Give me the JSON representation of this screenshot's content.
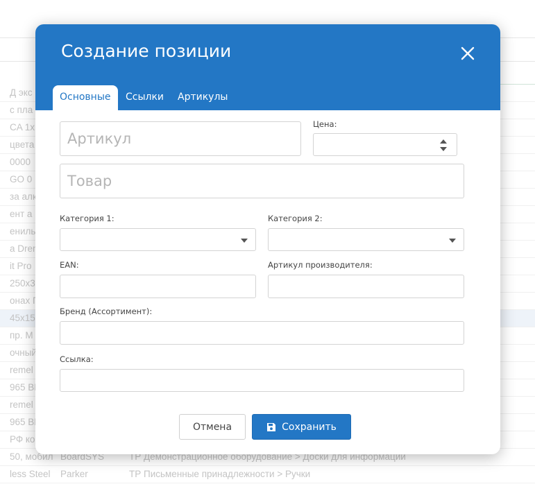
{
  "background": {
    "rows": [
      {
        "c1": "Д экс",
        "c2": "",
        "c3": ""
      },
      {
        "c1": "с пла",
        "c2": "",
        "c3": ""
      },
      {
        "c1": "CA 1х",
        "c2": "",
        "c3": ""
      },
      {
        "c1": "цвета",
        "c2": "",
        "c3": ""
      },
      {
        "c1": "0000",
        "c2": "",
        "c3": ""
      },
      {
        "c1": "GO 0",
        "c2": "",
        "c3": ""
      },
      {
        "c1": "за алк",
        "c2": "",
        "c3": ""
      },
      {
        "c1": "ент а",
        "c2": "",
        "c3": ""
      },
      {
        "c1": "ениль",
        "c2": "",
        "c3": ""
      },
      {
        "c1": "a Drem",
        "c2": "",
        "c3": ""
      },
      {
        "c1": "it Pro",
        "c2": "",
        "c3": ""
      },
      {
        "c1": "250х3",
        "c2": "",
        "c3": ""
      },
      {
        "c1": "онах Г",
        "c2": "",
        "c3": ""
      },
      {
        "c1": "45х15",
        "c2": "",
        "c3": ""
      },
      {
        "c1": "пр. М",
        "c2": "",
        "c3": ""
      },
      {
        "c1": "очный",
        "c2": "",
        "c3": ""
      },
      {
        "c1": "remel",
        "c2": "",
        "c3": ""
      },
      {
        "c1": "965 BE",
        "c2": "",
        "c3": ""
      },
      {
        "c1": "remel",
        "c2": "",
        "c3": ""
      },
      {
        "c1": "965 BE",
        "c2": "",
        "c3": ""
      },
      {
        "c1": "РФ ко",
        "c2": "",
        "c3": ""
      },
      {
        "c1": "50, мобил",
        "c2": "BoardSYS",
        "c3": "ТР Демонстрационное оборудование > Доски для информации"
      },
      {
        "c1": "less Steel",
        "c2": "Parker",
        "c3": "ТР Письменные принадлежности > Ручки"
      }
    ]
  },
  "modal": {
    "title": "Создание позиции",
    "tabs": [
      {
        "label": "Основные",
        "active": true
      },
      {
        "label": "Ссылки",
        "active": false
      },
      {
        "label": "Артикулы",
        "active": false
      }
    ],
    "form": {
      "article_placeholder": "Артикул",
      "product_placeholder": "Товар",
      "price_label": "Цена:",
      "category1_label": "Категория 1:",
      "category2_label": "Категория 2:",
      "ean_label": "EAN:",
      "manufacturer_article_label": "Артикул производителя:",
      "brand_label": "Бренд (Ассортимент):",
      "link_label": "Ссылка:"
    },
    "buttons": {
      "cancel_label": "Отмена",
      "save_label": "Сохранить"
    }
  },
  "colors": {
    "header": "#2377c5",
    "primary_button": "#2377c5",
    "background_text": "#c4c4c4"
  },
  "icons": [
    "close-icon",
    "save-icon",
    "chevron-down-icon",
    "spinner-arrows-icon"
  ]
}
